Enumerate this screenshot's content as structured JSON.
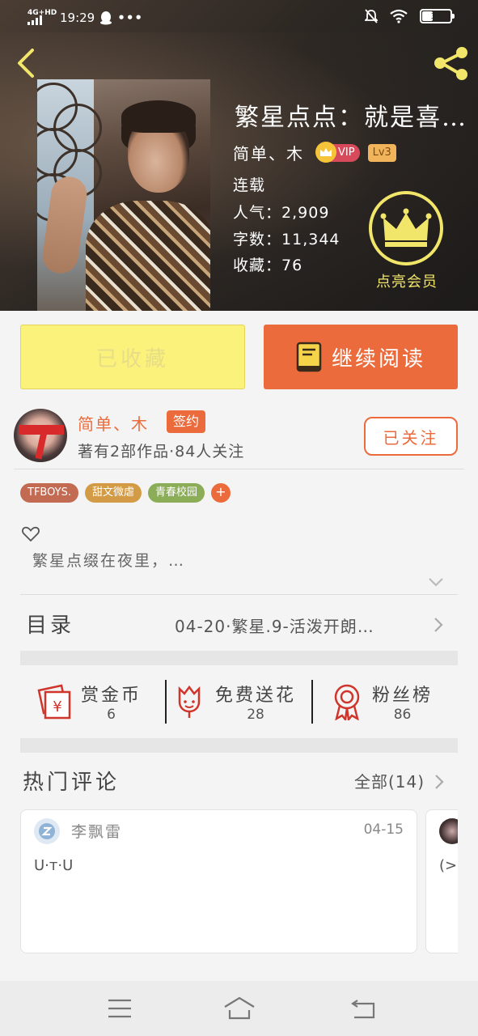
{
  "status_bar": {
    "network": "4G+HD",
    "time": "19:29",
    "more": "•••",
    "battery_level": "36"
  },
  "book": {
    "title": "繁星点点：就是喜…",
    "author": "简单、木",
    "vip_badge": "VIP",
    "level_badge": "Lv3",
    "serial_status": "连载",
    "popularity_label": "人气：",
    "popularity": "2,909",
    "word_count_label": "字数：",
    "word_count": "11,344",
    "favorites_label": "收藏：",
    "favorites": "76",
    "member_button": "点亮会员"
  },
  "actions": {
    "collected": "已收藏",
    "continue_reading": "继续阅读"
  },
  "author_card": {
    "name": "简单、木",
    "signed_badge": "签约",
    "stats": "著有2部作品·84人关注",
    "follow_button": "已关注"
  },
  "tags": [
    "TFBOYS.",
    "甜文微虐",
    "青春校园"
  ],
  "tag_add": "+",
  "summary": "繁星点缀在夜里，…",
  "toc": {
    "label": "目录",
    "latest": "04-20·繁星.9-活泼开朗…"
  },
  "stats": [
    {
      "label": "赏金币",
      "value": "6",
      "icon": "red-envelope-icon"
    },
    {
      "label": "免费送花",
      "value": "28",
      "icon": "flower-icon"
    },
    {
      "label": "粉丝榜",
      "value": "86",
      "icon": "medal-icon"
    }
  ],
  "comments": {
    "title": "热门评论",
    "all_link": "全部(14)",
    "items": [
      {
        "user": "李飘雷",
        "date": "04-15",
        "text": "U·ᴛ·U"
      },
      {
        "user": "",
        "date": "",
        "text": "(>"
      }
    ]
  },
  "colors": {
    "accent": "#ec6b3c",
    "collected_bg": "#fbf27c",
    "member_gold": "#f2e66a"
  }
}
